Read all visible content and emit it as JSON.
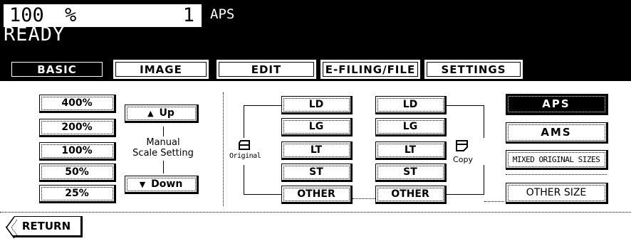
{
  "header": {
    "ratio": "100",
    "ratio_unit": "%",
    "copies": "1",
    "mode": "APS",
    "status": "READY"
  },
  "tabs": [
    {
      "label": "BASIC",
      "active": true
    },
    {
      "label": "IMAGE"
    },
    {
      "label": "EDIT"
    },
    {
      "label": "E-FILING/FILE"
    },
    {
      "label": "SETTINGS"
    }
  ],
  "zoom": {
    "presets": [
      "400%",
      "200%",
      "100%",
      "50%",
      "25%"
    ],
    "up_label": "Up",
    "down_label": "Down",
    "manual_label_line1": "Manual",
    "manual_label_line2": "Scale Setting"
  },
  "original": {
    "label": "Original",
    "sizes": [
      "LD",
      "LG",
      "LT",
      "ST",
      "OTHER"
    ]
  },
  "copy": {
    "label": "Copy",
    "sizes": [
      "LD",
      "LG",
      "LT",
      "ST",
      "OTHER"
    ]
  },
  "paper_mode": {
    "aps_label": "APS",
    "ams_label": "AMS",
    "mixed_label": "MIXED ORIGINAL SIZES",
    "other_size_label": "OTHER SIZE"
  },
  "return_label": "RETURN"
}
